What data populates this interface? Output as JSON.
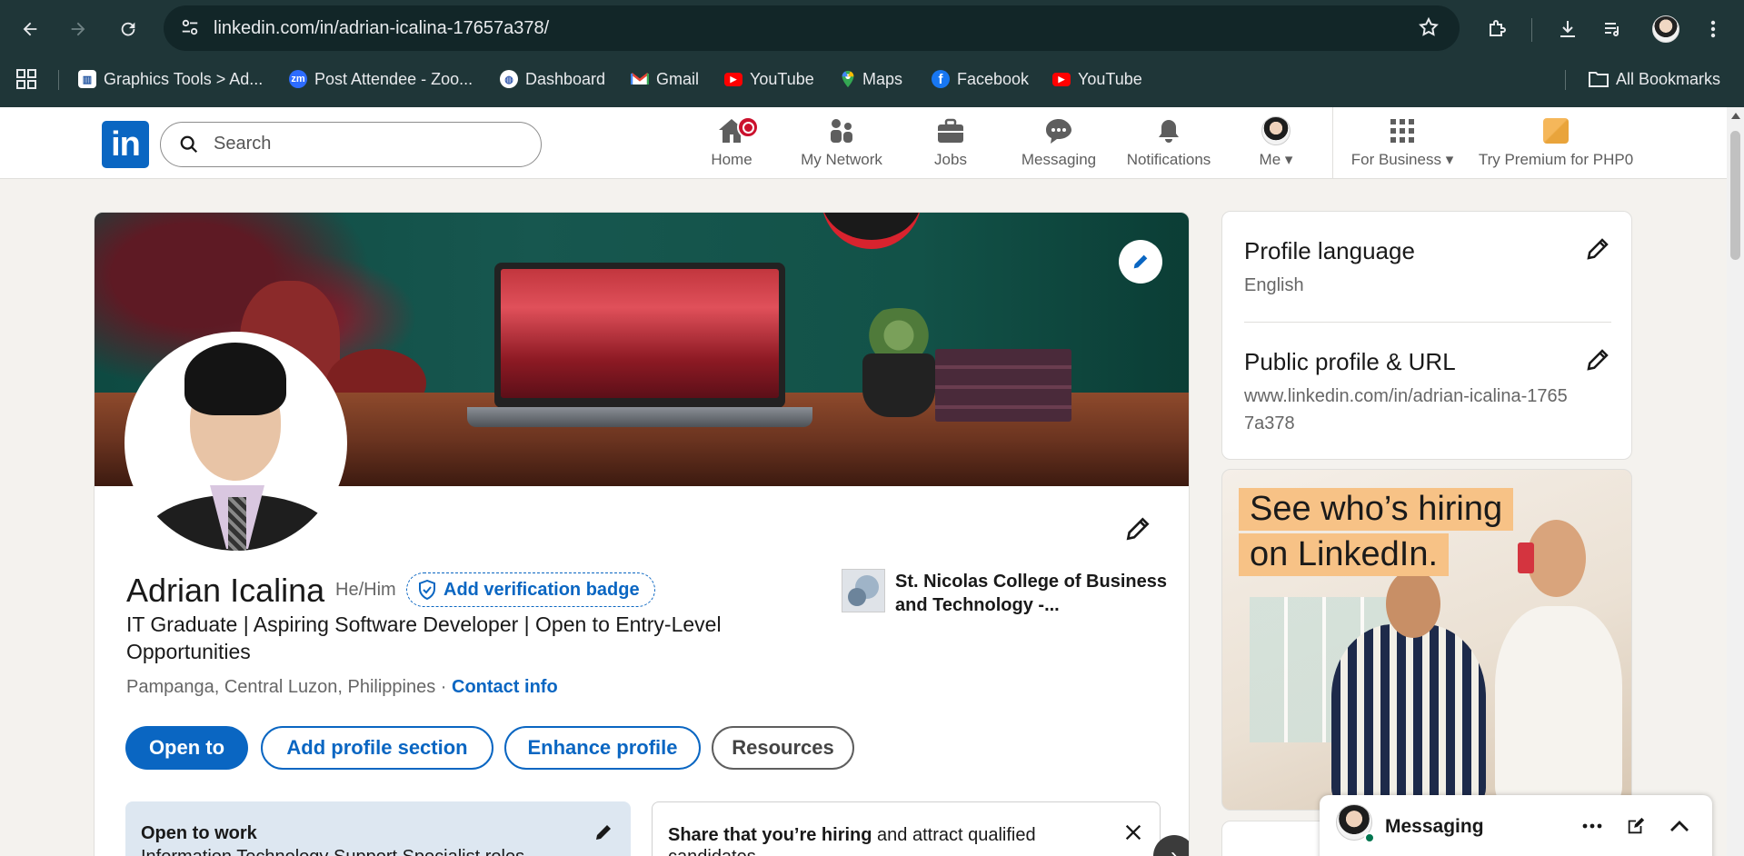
{
  "browser": {
    "url": "linkedin.com/in/adrian-icalina-17657a378/",
    "bookmarks": [
      {
        "label": "Graphics Tools > Ad...",
        "icon": "graphics-tools-icon"
      },
      {
        "label": "Post Attendee - Zoo...",
        "icon": "zoom-icon"
      },
      {
        "label": "Dashboard",
        "icon": "dashboard-icon"
      },
      {
        "label": "Gmail",
        "icon": "gmail-icon"
      },
      {
        "label": "YouTube",
        "icon": "youtube-icon"
      },
      {
        "label": "Maps",
        "icon": "maps-icon"
      },
      {
        "label": "Facebook",
        "icon": "facebook-icon"
      },
      {
        "label": "YouTube",
        "icon": "youtube-icon"
      }
    ],
    "all_bookmarks": "All Bookmarks"
  },
  "header": {
    "logo": "in",
    "search_placeholder": "Search",
    "nav": [
      {
        "label": "Home",
        "icon": "home-icon"
      },
      {
        "label": "My Network",
        "icon": "my-network-icon"
      },
      {
        "label": "Jobs",
        "icon": "jobs-icon"
      },
      {
        "label": "Messaging",
        "icon": "messaging-icon"
      },
      {
        "label": "Notifications",
        "icon": "notifications-icon"
      },
      {
        "label": "Me",
        "icon": "avatar"
      },
      {
        "label": "For Business",
        "icon": "grid-icon"
      },
      {
        "label": "Try Premium for PHP0",
        "icon": "premium-icon"
      }
    ]
  },
  "profile": {
    "name": "Adrian Icalina",
    "pronouns": "He/Him",
    "verify_label": "Add verification badge",
    "headline": "IT Graduate | Aspiring Software Developer | Open to Entry-Level Opportunities",
    "location": "Pampanga, Central Luzon, Philippines",
    "separator": "·",
    "contact_info": "Contact info",
    "education": "St. Nicolas College of Business and Technology -...",
    "buttons": {
      "open_to": "Open to",
      "add_section": "Add profile section",
      "enhance": "Enhance profile",
      "resources": "Resources"
    },
    "open_to_work": {
      "title": "Open to work",
      "subtitle": "Information Technology Support Specialist roles"
    },
    "hiring": {
      "bold": "Share that you’re hiring",
      "rest": " and attract qualified candidates"
    }
  },
  "sidebar": {
    "profile_language_title": "Profile language",
    "profile_language_value": "English",
    "public_profile_title": "Public profile & URL",
    "public_profile_value": "www.linkedin.com/in/adrian-icalina-17657a378"
  },
  "ad": {
    "line1": "See who’s hiring",
    "line2": "on LinkedIn."
  },
  "messaging": {
    "label": "Messaging"
  },
  "colors": {
    "brand": "#0a66c2",
    "chrome": "#1f3638",
    "notification": "#cb112d"
  }
}
